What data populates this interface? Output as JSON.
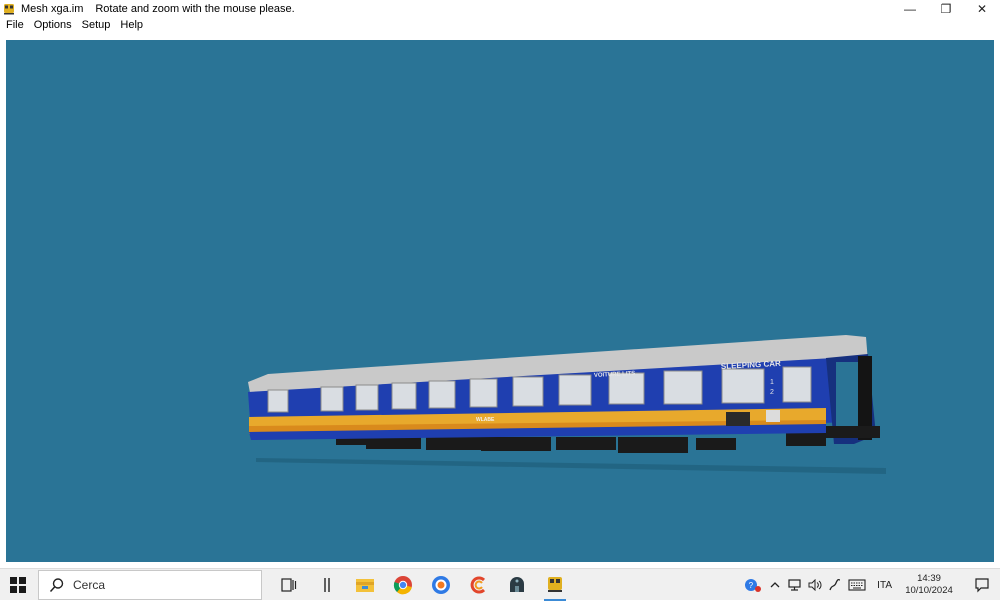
{
  "window": {
    "file_name": "Mesh xga.im",
    "message": "Rotate and zoom with the mouse please.",
    "controls": {
      "minimize": "—",
      "restore": "❐",
      "close": "✕"
    }
  },
  "menu": {
    "items": [
      {
        "label": "File"
      },
      {
        "label": "Options"
      },
      {
        "label": "Setup"
      },
      {
        "label": "Help"
      }
    ]
  },
  "viewport": {
    "background": "#2a7496",
    "model": {
      "name": "sleeping car",
      "lettering": {
        "sleeping": "SLEEPING CAR",
        "company": "VOITURE LITS",
        "owner": "WLABE",
        "classes": [
          "1",
          "2"
        ]
      },
      "colors": {
        "body": "#1f3fb0",
        "roof": "#c8c8c8",
        "stripe": "#e8a92c",
        "windows": "#d9dde2"
      }
    }
  },
  "taskbar": {
    "search_placeholder": "Cerca",
    "apps": [
      {
        "name": "task-view-icon"
      },
      {
        "name": "multitask-icon"
      },
      {
        "name": "file-explorer-icon"
      },
      {
        "name": "chrome-icon"
      },
      {
        "name": "firefox-icon"
      },
      {
        "name": "ccleaner-icon"
      },
      {
        "name": "game-app-icon"
      },
      {
        "name": "mesh-viewer-icon"
      }
    ],
    "tray": {
      "language": "ITA",
      "time": "14:39",
      "date": "10/10/2024"
    }
  }
}
